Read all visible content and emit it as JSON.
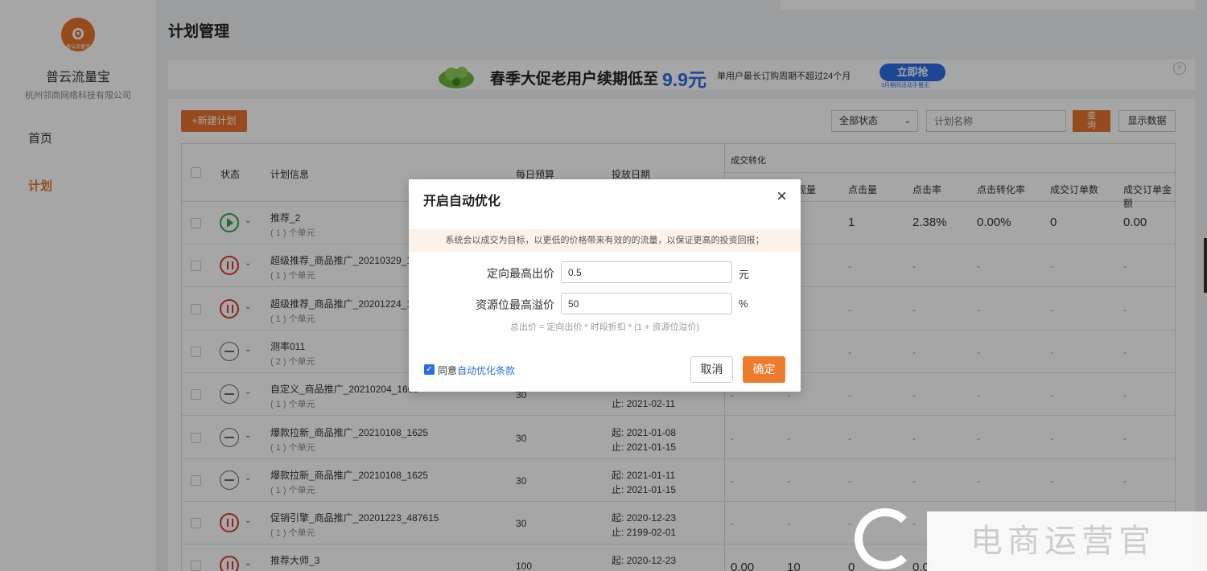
{
  "sidebar": {
    "logo_text": "普云流量宝",
    "brand": "普云流量宝",
    "company": "杭州邻商网络科技有限公司",
    "nav": [
      {
        "label": "首页",
        "active": false
      },
      {
        "label": "计划",
        "active": true
      }
    ]
  },
  "page_title": "计划管理",
  "banner": {
    "title": "春季大促老用户续期低至",
    "price": "9.9元",
    "subtitle": "单用户最长订购周期不超过24个月",
    "button": "立即抢",
    "button_sub": "3月期间活动手慢无"
  },
  "toolbar": {
    "new_plan": "+新建计划",
    "status_select": "全部状态",
    "search_placeholder": "计划名称",
    "query": "查询",
    "show_data": "显示数据"
  },
  "table": {
    "headers": {
      "status": "状态",
      "plan_info": "计划信息",
      "budget": "每日预算",
      "date": "投放日期",
      "group": "成交转化",
      "impressions": "展现量",
      "clicks": "点击量",
      "ctr": "点击率",
      "cvr": "点击转化率",
      "orders": "成交订单数",
      "amount": "成交订单金额"
    },
    "rows": [
      {
        "status": "play",
        "name": "推荐_2",
        "units": "( 1 ) 个单元",
        "budget": "",
        "start": "",
        "end": "",
        "clicks": "1",
        "ctr": "2.38%",
        "cvr": "0.00%",
        "orders": "0",
        "amount": "0.00"
      },
      {
        "status": "pause",
        "name": "超级推荐_商品推广_20210329_10",
        "units": "( 1 ) 个单元",
        "budget": "",
        "start": "",
        "end": ""
      },
      {
        "status": "pause",
        "name": "超级推荐_商品推广_20201224_10",
        "units": "( 1 ) 个单元",
        "budget": "",
        "start": "",
        "end": ""
      },
      {
        "status": "stop",
        "name": "测率011",
        "units": "( 2 ) 个单元",
        "budget": "",
        "start": "",
        "end": ""
      },
      {
        "status": "stop",
        "name": "自定义_商品推广_20210204_1605",
        "units": "( 1 ) 个单元",
        "budget": "30",
        "start": "",
        "end": "止: 2021-02-11"
      },
      {
        "status": "stop",
        "name": "爆款拉新_商品推广_20210108_1625",
        "units": "( 1 ) 个单元",
        "budget": "30",
        "start": "起: 2021-01-08",
        "end": "止: 2021-01-15"
      },
      {
        "status": "stop",
        "name": "爆款拉新_商品推广_20210108_1625",
        "units": "( 1 ) 个单元",
        "budget": "30",
        "start": "起: 2021-01-11",
        "end": "止: 2021-01-15"
      },
      {
        "status": "pause",
        "name": "促销引擎_商品推广_20201223_487615",
        "units": "( 1 ) 个单元",
        "budget": "30",
        "start": "起: 2020-12-23",
        "end": "止: 2199-02-01"
      },
      {
        "status": "pause",
        "name": "推荐大师_3",
        "units": "",
        "budget": "100",
        "start": "起: 2020-12-23",
        "end": "",
        "imp": "0.00",
        "clicks": "10",
        "ctr": "0",
        "cvr": "0.0"
      }
    ],
    "dash": "-"
  },
  "modal": {
    "title": "开启自动优化",
    "close": "×",
    "notice": "系统会以成交为目标，以更低的价格带来有效的的流量，以保证更高的投资回报；",
    "field1_label": "定向最高出价",
    "field1_value": "0.5",
    "field1_unit": "元",
    "field2_label": "资源位最高溢价",
    "field2_value": "50",
    "field2_unit": "%",
    "formula": "总出价 = 定向出价 * 时段折扣 * (1 + 资源位溢价)",
    "agree_prefix": "同意",
    "agree_link": "自动优化条款",
    "cancel": "取消",
    "ok": "确定"
  },
  "watermark": {
    "text": "电商运营官"
  },
  "colors": {
    "accent": "#e9742d",
    "blue": "#2a6de3",
    "green": "#2aa84a",
    "red": "#d9362f"
  }
}
